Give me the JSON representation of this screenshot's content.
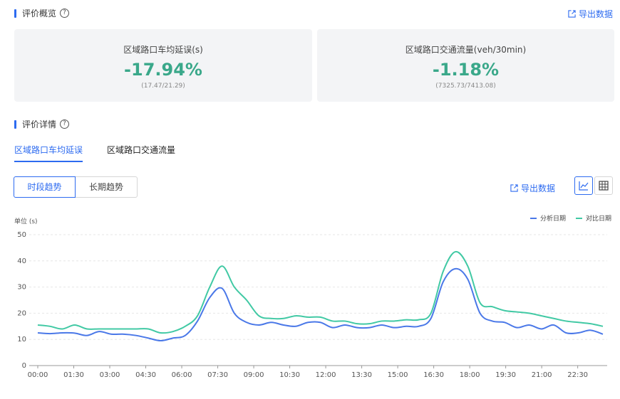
{
  "overview": {
    "title": "评价概览",
    "export_label": "导出数据",
    "cards": [
      {
        "label": "区域路口车均延误(s)",
        "value": "-17.94%",
        "sub": "(17.47/21.29)"
      },
      {
        "label": "区域路口交通流量(veh/30min)",
        "value": "-1.18%",
        "sub": "(7325.73/7413.08)"
      }
    ]
  },
  "details": {
    "title": "评价详情",
    "tabs": [
      "区域路口车均延误",
      "区域路口交通流量"
    ],
    "segments": [
      "时段趋势",
      "长期趋势"
    ],
    "export_label": "导出数据",
    "view_icons": [
      "line-chart-icon",
      "table-grid-icon"
    ]
  },
  "colors": {
    "accent": "#2d6bf0",
    "positive": "#3aa88a",
    "series_analysis": "#4a78e8",
    "series_compare": "#41c9a4"
  },
  "chart_data": {
    "type": "line",
    "unit_label": "单位 (s)",
    "ylim": [
      0,
      50
    ],
    "yticks": [
      0,
      10,
      20,
      30,
      40,
      50
    ],
    "xlabels": [
      "00:00",
      "01:30",
      "03:00",
      "04:30",
      "06:00",
      "07:30",
      "09:00",
      "10:30",
      "12:00",
      "13:30",
      "15:00",
      "16:30",
      "18:00",
      "19:30",
      "21:00",
      "22:30"
    ],
    "grid": true,
    "legend_position": "top-right",
    "series": [
      {
        "name": "分析日期",
        "color": "#4a78e8",
        "values": [
          12.5,
          12.2,
          12.5,
          12.4,
          11.5,
          13,
          12,
          12,
          11.5,
          10.5,
          9.5,
          10.5,
          11.5,
          17,
          26,
          29.5,
          20,
          16.5,
          15.5,
          16.5,
          15.5,
          15,
          16.5,
          16.5,
          14.5,
          15.5,
          14.5,
          14.5,
          15.5,
          14.5,
          15,
          15,
          18,
          32,
          37,
          33,
          20,
          17,
          16.5,
          14.5,
          15.5,
          14,
          15.5,
          12.5,
          12.5,
          13.5,
          12
        ]
      },
      {
        "name": "对比日期",
        "color": "#41c9a4",
        "values": [
          15.5,
          15,
          14,
          15.5,
          14,
          14,
          14,
          14,
          14,
          14,
          12.5,
          13,
          15,
          19,
          30,
          38,
          30,
          25,
          19,
          18,
          18,
          19,
          18.5,
          18.5,
          17,
          17,
          16,
          16,
          17,
          17,
          17.5,
          17.5,
          20,
          36,
          43.5,
          38,
          24,
          22.5,
          21,
          20.5,
          20,
          19,
          18,
          17,
          16.5,
          16,
          15
        ]
      }
    ]
  }
}
